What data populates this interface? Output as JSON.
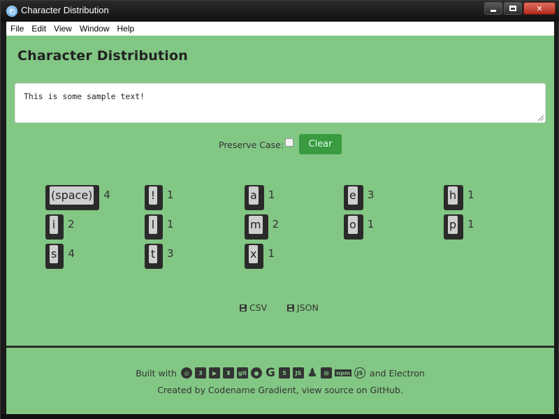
{
  "window": {
    "title": "Character Distribution",
    "controls": {
      "minimize": "minimize",
      "maximize": "maximize",
      "close": "✕"
    }
  },
  "menu": [
    "File",
    "Edit",
    "View",
    "Window",
    "Help"
  ],
  "page": {
    "title": "Character Distribution",
    "input_text": "This is some sample text!",
    "preserve_case_label": "Preserve Case:",
    "preserve_case_checked": false,
    "clear_label": "Clear"
  },
  "characters": [
    {
      "char": "(space)",
      "count": "4"
    },
    {
      "char": "!",
      "count": "1"
    },
    {
      "char": "a",
      "count": "1"
    },
    {
      "char": "e",
      "count": "3"
    },
    {
      "char": "h",
      "count": "1"
    },
    {
      "char": "i",
      "count": "2"
    },
    {
      "char": "l",
      "count": "1"
    },
    {
      "char": "m",
      "count": "2"
    },
    {
      "char": "o",
      "count": "1"
    },
    {
      "char": "p",
      "count": "1"
    },
    {
      "char": "s",
      "count": "4"
    },
    {
      "char": "t",
      "count": "3"
    },
    {
      "char": "x",
      "count": "1"
    }
  ],
  "downloads": {
    "csv_label": "CSV",
    "json_label": "JSON"
  },
  "footer": {
    "built_with": "Built with",
    "and_electron": "and Electron",
    "credit": "Created by Codename Gradient, view source on GitHub.",
    "tech_icons": [
      "chrome-icon",
      "css3-icon",
      "flag-icon",
      "castle-icon",
      "git-icon",
      "github-icon",
      "google-icon",
      "html5-icon",
      "js-square-icon",
      "linux-icon",
      "windows-icon",
      "npm-icon",
      "nodejs-icon"
    ]
  },
  "colors": {
    "background": "#82c784",
    "accent_button": "#3a9a3f",
    "key_dark": "#2a2a2a",
    "key_face": "#cfcfcf"
  }
}
